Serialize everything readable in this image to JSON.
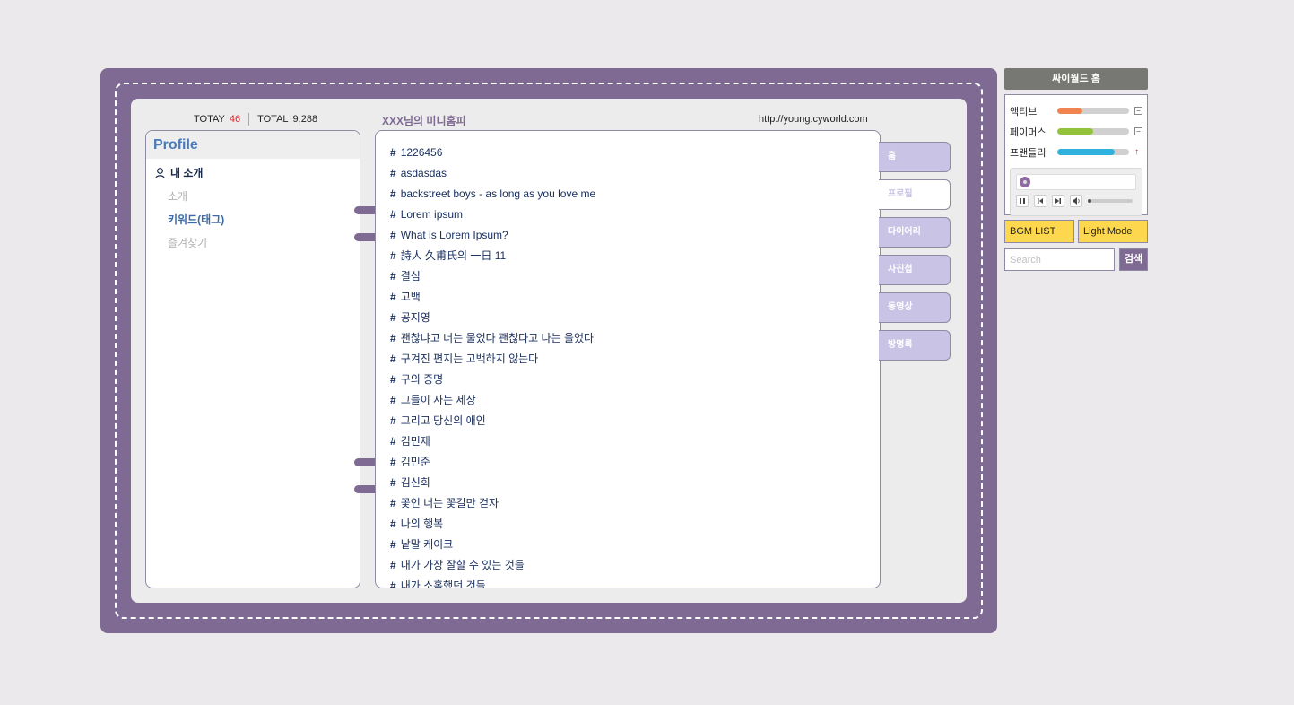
{
  "counter": {
    "today_label": "TOTAY",
    "today_value": "46",
    "total_label": "TOTAL",
    "total_value": "9,288"
  },
  "header": {
    "title": "XXX님의 미니홈피",
    "url": "http://young.cyworld.com"
  },
  "profile": {
    "heading": "Profile",
    "main_item": "내 소개",
    "sub_items": [
      {
        "label": "소개",
        "active": false
      },
      {
        "label": "키워드(태그)",
        "active": true
      },
      {
        "label": "즐겨찾기",
        "active": false
      }
    ]
  },
  "tags": [
    "1226456",
    "asdasdas",
    "backstreet boys - as long as you love me",
    "Lorem ipsum",
    "What is Lorem Ipsum?",
    "詩人 久甫氏의 一日 11",
    "결심",
    "고백",
    "공지영",
    "괜찮냐고 너는 물었다 괜찮다고 나는 울었다",
    "구겨진 편지는 고백하지 않는다",
    "구의 증명",
    "그들이 사는 세상",
    "그리고 당신의 애인",
    "김민제",
    "김민준",
    "김신회",
    "꽃인 너는 꽃길만 걷자",
    "나의 행복",
    "낱말 케이크",
    "내가 가장 잘할 수 있는 것들",
    "내가 소홀했던 것들"
  ],
  "tag_hash": "#",
  "nav_tabs": [
    {
      "label": "홈",
      "active": false
    },
    {
      "label": "프로필",
      "active": true
    },
    {
      "label": "다이어리",
      "active": false
    },
    {
      "label": "사진첩",
      "active": false
    },
    {
      "label": "동영상",
      "active": false
    },
    {
      "label": "방명록",
      "active": false
    }
  ],
  "sidebar": {
    "home_button": "싸이월드 홈",
    "stats": [
      {
        "label": "액티브",
        "level": 0.35,
        "color": "#f0834f",
        "indicator": "minus-icon"
      },
      {
        "label": "페이머스",
        "level": 0.5,
        "color": "#93c33b",
        "indicator": "minus-icon"
      },
      {
        "label": "프랜들리",
        "level": 0.8,
        "color": "#2fb2dc",
        "indicator": "up-arrow-icon"
      }
    ],
    "player": {
      "volume_level": 0.05
    },
    "bgm_button": "BGM LIST",
    "mode_button": "Light Mode",
    "search_placeholder": "Search",
    "search_button": "검색"
  },
  "colors": {
    "frame": "#7f6a93",
    "tab": "#c9c4e5",
    "accent_yellow": "#fdd84e",
    "profile_heading": "#4a7ab8"
  }
}
